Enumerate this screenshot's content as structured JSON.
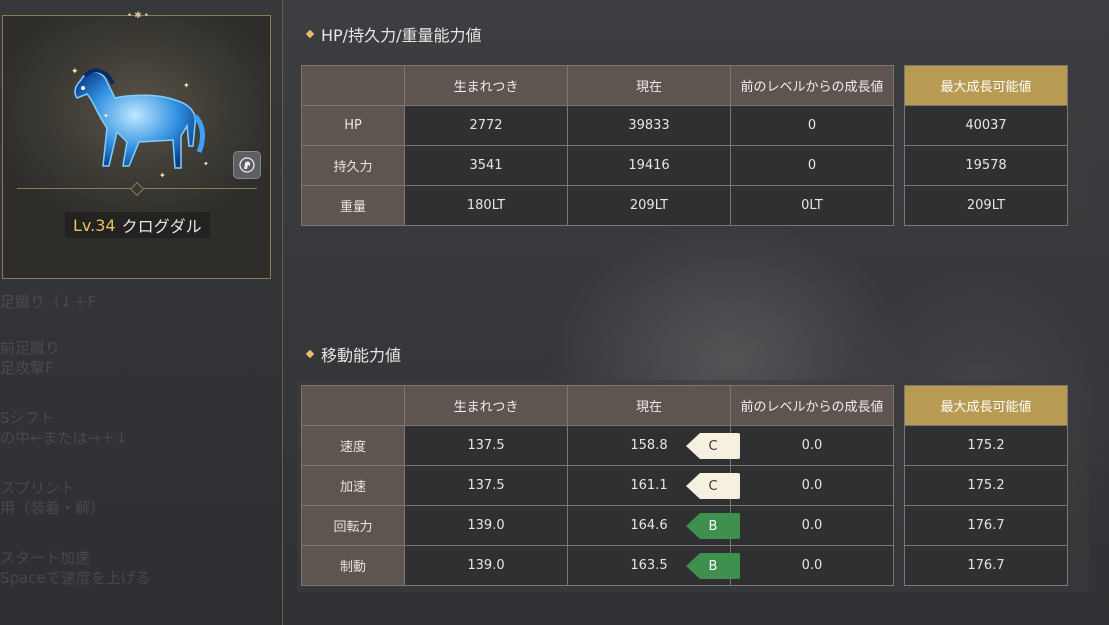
{
  "left_panel": {
    "ghost_rows": [
      {
        "line1": "足蹴り（↓＋F",
        "line2": ""
      },
      {
        "line1": "前足蹴り",
        "line2": "足攻撃F"
      },
      {
        "line1": "Sシフト",
        "line2": "の中←または→＋↓"
      },
      {
        "line1": "スプリント",
        "line2": "用（装着・解）"
      },
      {
        "line1": "スタート加速",
        "line2": "Spaceで速度を上げる"
      }
    ]
  },
  "horse_card": {
    "level_prefix": "Lv.34",
    "name": "クログダル"
  },
  "hp_section": {
    "title": "HP/持久力/重量能力値",
    "headers": [
      "生まれつき",
      "現在",
      "前のレベルからの成長値",
      "最大成長可能値"
    ],
    "rows": [
      {
        "label": "HP",
        "born": "2772",
        "current": "39833",
        "growth": "0",
        "max": "40037"
      },
      {
        "label": "持久力",
        "born": "3541",
        "current": "19416",
        "growth": "0",
        "max": "19578"
      },
      {
        "label": "重量",
        "born": "180LT",
        "current": "209LT",
        "growth": "0LT",
        "max": "209LT"
      }
    ]
  },
  "move_section": {
    "title": "移動能力値",
    "headers": [
      "生まれつき",
      "現在",
      "前のレベルからの成長値",
      "最大成長可能値"
    ],
    "rows": [
      {
        "label": "速度",
        "born": "137.5",
        "current": "158.8",
        "grade": "C",
        "growth": "0.0",
        "max": "175.2"
      },
      {
        "label": "加速",
        "born": "137.5",
        "current": "161.1",
        "grade": "C",
        "growth": "0.0",
        "max": "175.2"
      },
      {
        "label": "回転力",
        "born": "139.0",
        "current": "164.6",
        "grade": "B",
        "growth": "0.0",
        "max": "176.7"
      },
      {
        "label": "制動",
        "born": "139.0",
        "current": "163.5",
        "grade": "B",
        "growth": "0.0",
        "max": "176.7"
      }
    ]
  },
  "colors": {
    "accent_gold": "#b89a52",
    "grade_c": "#f5f0e0",
    "grade_b": "#3f8f4f"
  }
}
